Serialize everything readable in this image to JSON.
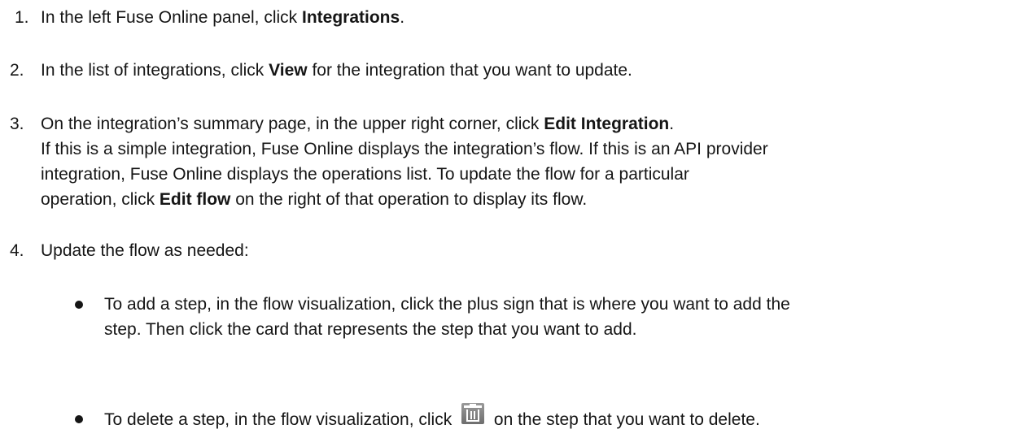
{
  "steps": [
    {
      "number": "1.",
      "pre": "In the left Fuse Online panel, click ",
      "bold": "Integrations",
      "post": "."
    },
    {
      "number": "2.",
      "pre": "In the list of integrations, click ",
      "bold": "View",
      "post": " for the integration that you want to update."
    },
    {
      "number": "3.",
      "pre": "On the integration’s summary page, in the upper right corner, click ",
      "bold": "Edit Integration",
      "post": ".",
      "detail_line_1": "If this is a simple integration, Fuse Online displays the integration’s flow. If this is an API provider",
      "detail_line_2": "integration, Fuse Online displays the operations list. To update the flow for a particular",
      "detail_line_3_pre": "operation, click ",
      "detail_line_3_bold": "Edit flow",
      "detail_line_3_post": " on the right of that operation to display its flow."
    },
    {
      "number": "4.",
      "text": "Update the flow as needed:",
      "bullets": [
        {
          "line_1": "To add a step, in the flow visualization, click the plus sign that is where you want to add the",
          "line_2": "step. Then click the card that represents the step that you want to add."
        },
        {
          "pre": "To delete a step, in the flow visualization, click ",
          "icon": "trash-icon",
          "post": " on the step that you want to delete."
        }
      ]
    }
  ]
}
